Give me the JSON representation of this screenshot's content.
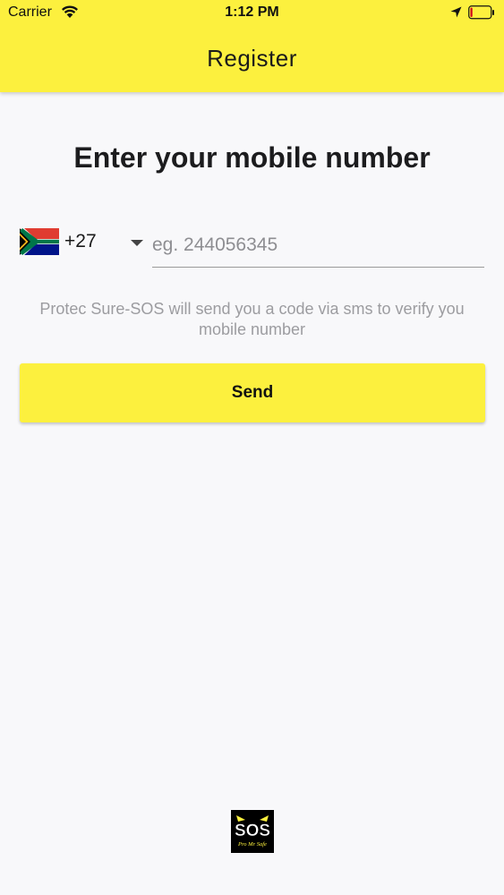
{
  "status_bar": {
    "carrier": "Carrier",
    "time": "1:12 PM",
    "icons": [
      "wifi-icon",
      "location-arrow-icon",
      "battery-icon"
    ]
  },
  "nav": {
    "title": "Register"
  },
  "main": {
    "heading": "Enter your mobile number",
    "country": {
      "flag": "south-africa-flag-icon",
      "dial_code": "+27"
    },
    "phone_input": {
      "value": "",
      "placeholder": "eg. 244056345"
    },
    "info_text": "Protec Sure-SOS will send you a code via sms to verify you mobile number",
    "send_label": "Send"
  },
  "footer": {
    "logo": "SOS",
    "logo_tagline": "Pro Mr Safe"
  },
  "colors": {
    "accent": "#fcf03e",
    "background": "#f8f8fa",
    "text": "#1b1b1b",
    "muted": "#9c9ca0"
  }
}
